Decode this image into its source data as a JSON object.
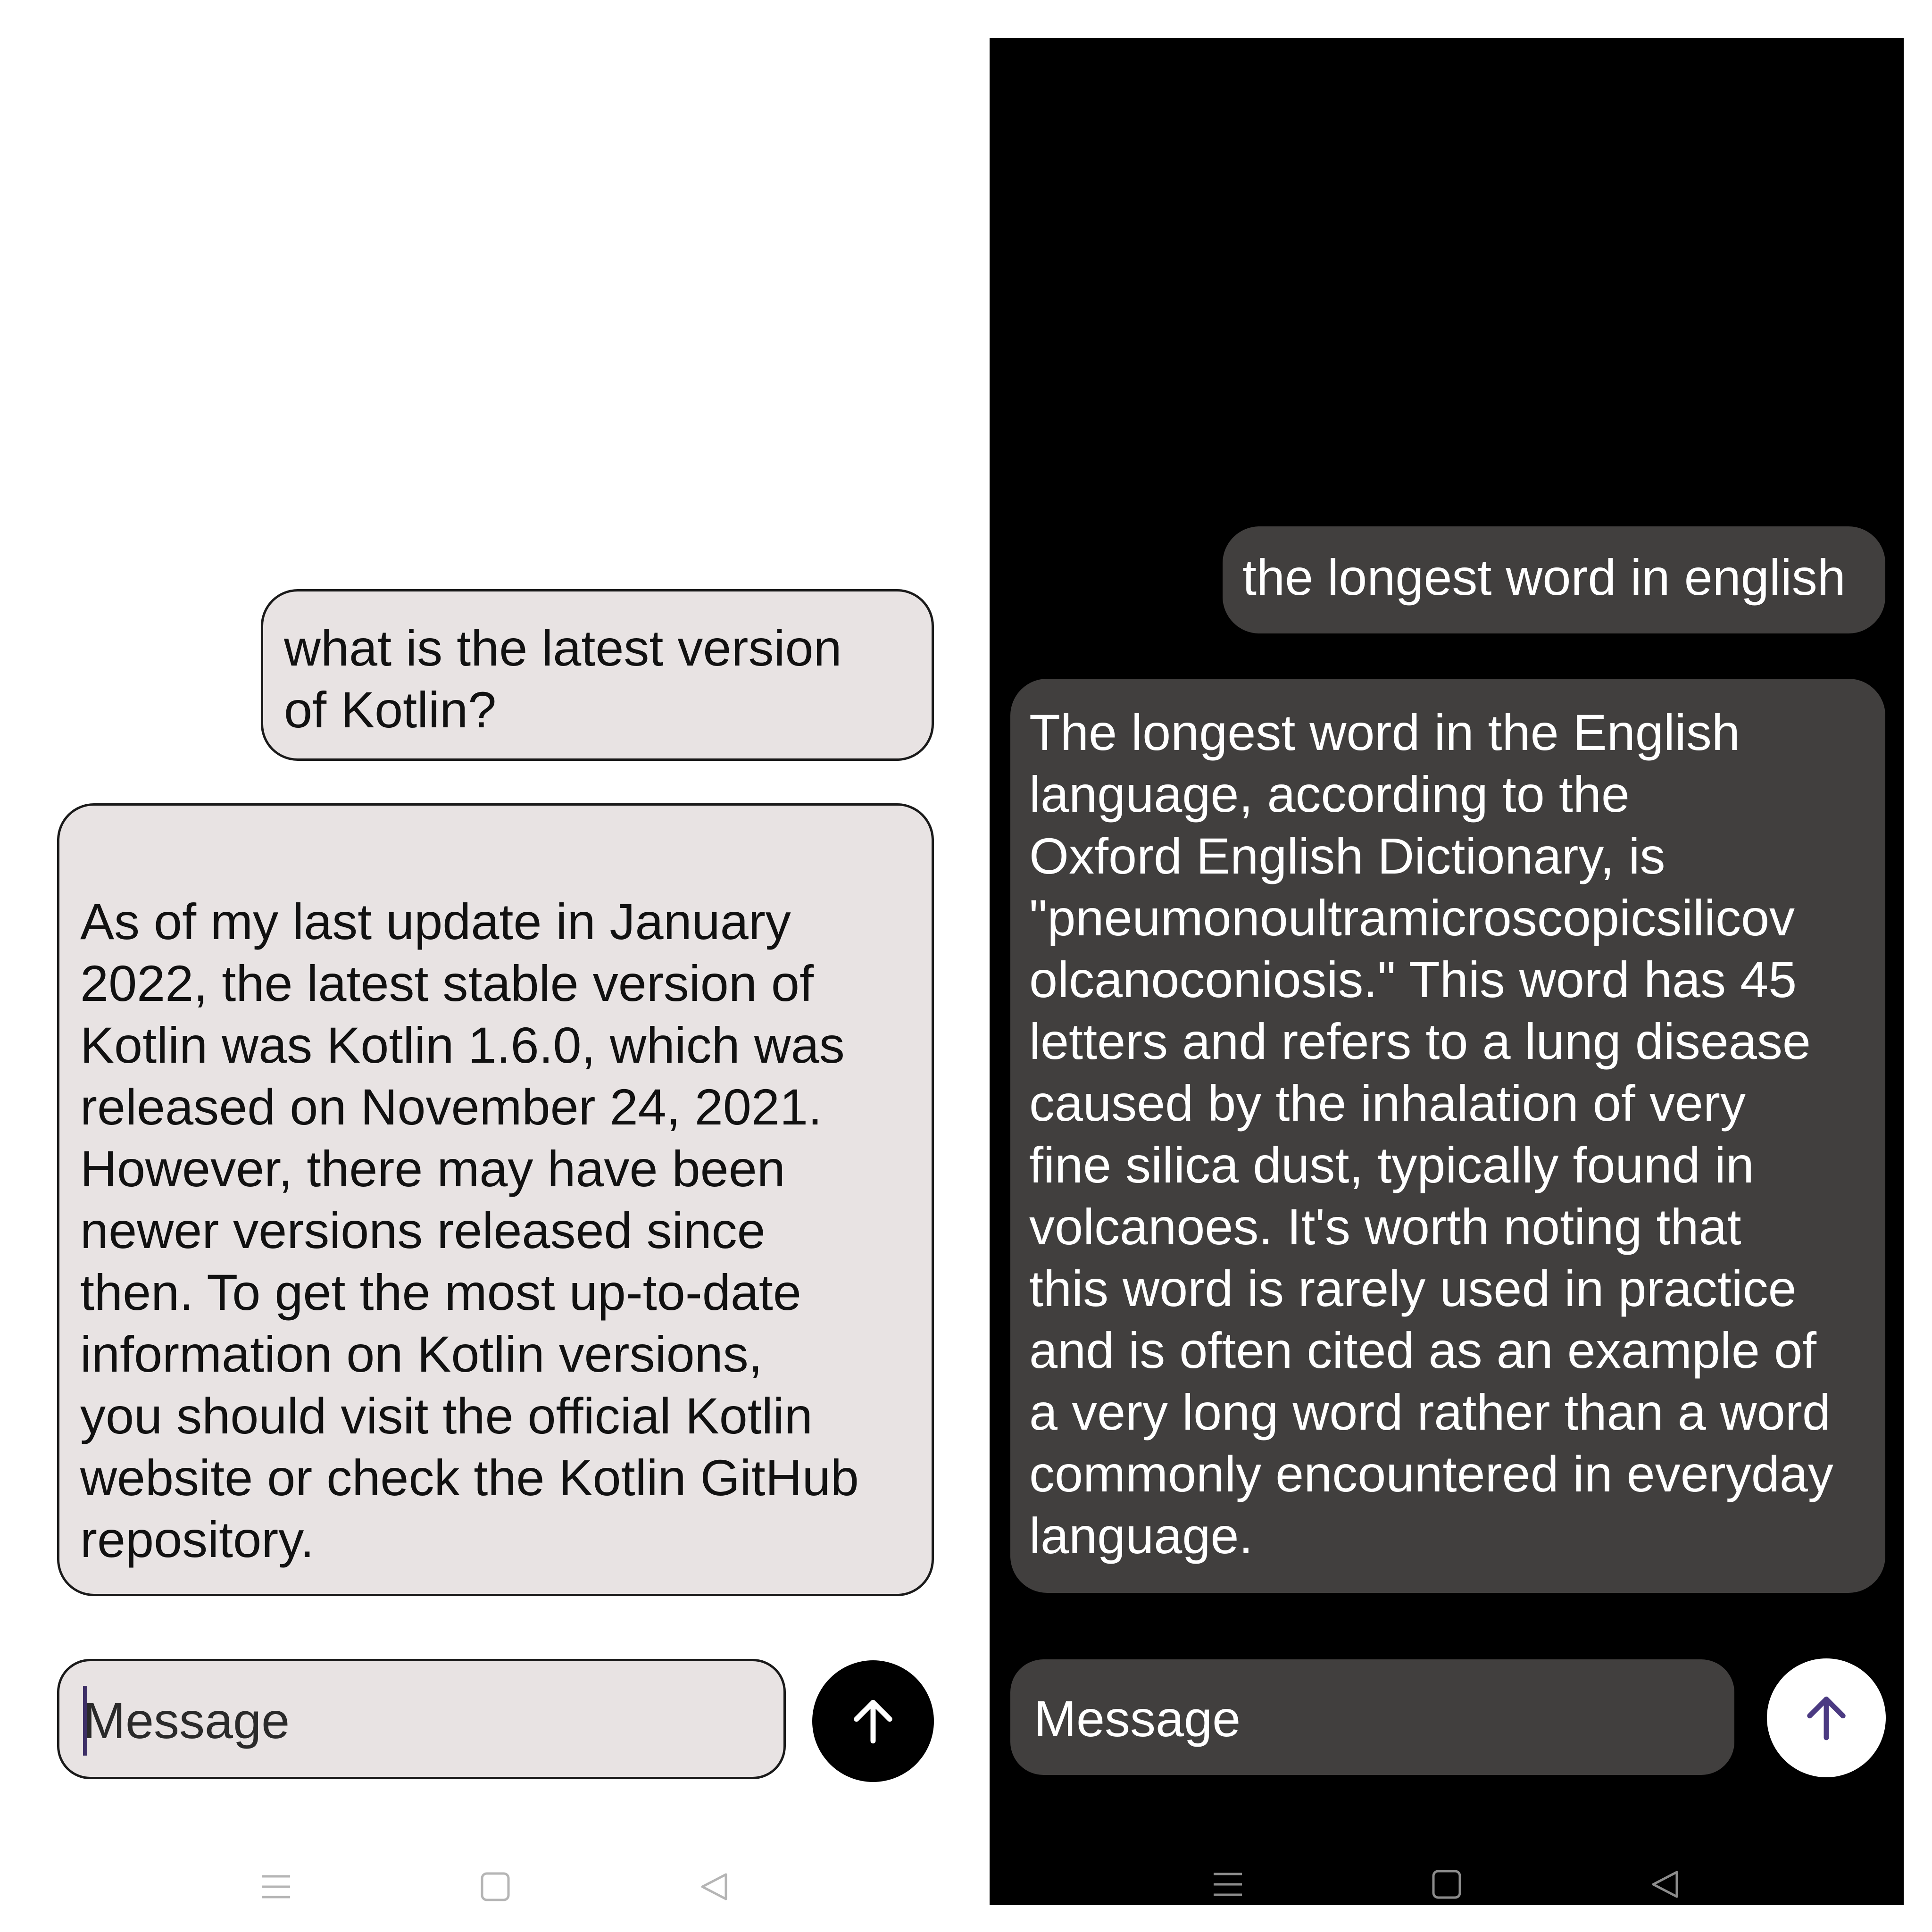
{
  "light_screen": {
    "user_message": "what is the latest version\nof Kotlin?",
    "assistant_message": "As of my last update in January\n2022, the latest stable version of\nKotlin was Kotlin 1.6.0, which was\nreleased on November 24, 2021.\nHowever, there may have been\nnewer versions released since\nthen. To get the most up-to-date\ninformation on Kotlin versions,\nyou should visit the official Kotlin\nwebsite or check the Kotlin GitHub\nrepository.",
    "input_placeholder": "Message",
    "send_icon": "arrow-up-icon",
    "colors": {
      "bubble": "#e8e3e3",
      "send_button": "#000000",
      "caret": "#3d2f66"
    }
  },
  "dark_screen": {
    "user_message": "the longest word in english",
    "assistant_message": "The longest word in the English\nlanguage, according to the\nOxford English Dictionary, is\n\"pneumonoultramicroscopicsilicov\nolcanoconiosis.\" This word has 45\nletters and refers to a lung disease\ncaused by the inhalation of very\nfine silica dust, typically found in\nvolcanoes. It's worth noting that\nthis word is rarely used in practice\nand is often cited as an example of\na very long word rather than a word\ncommonly encountered in everyday\nlanguage.",
    "input_placeholder": "Message",
    "send_icon": "arrow-up-icon",
    "colors": {
      "bubble": "#413f3e",
      "send_button": "#ffffff",
      "send_arrow": "#4b3a82"
    }
  },
  "nav_bar": {
    "icons": [
      "menu-icon",
      "home-square-icon",
      "back-triangle-icon"
    ]
  }
}
